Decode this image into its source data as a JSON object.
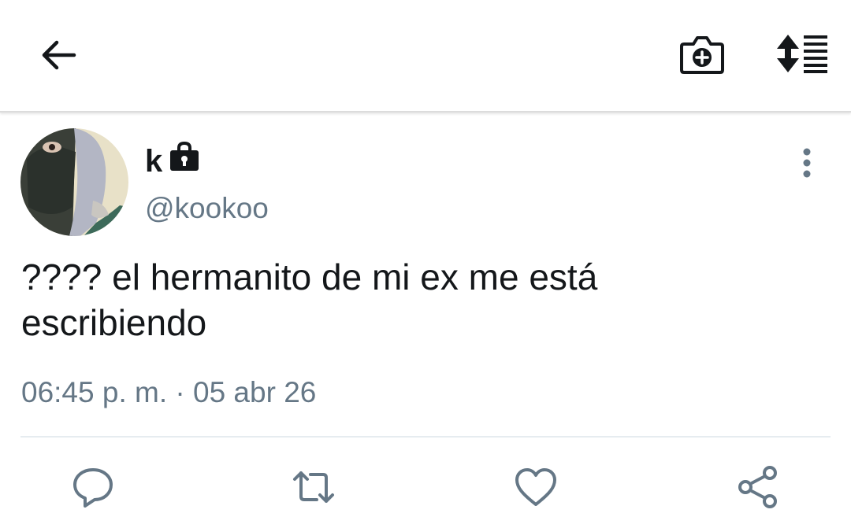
{
  "header": {
    "back_icon": "arrow-left-icon",
    "camera_icon": "camera-plus-icon",
    "sort_icon": "sort-list-icon"
  },
  "tweet": {
    "display_name": "k",
    "protected_icon": "lock-icon",
    "handle": "@kookoo",
    "text": "???? el hermanito de mi ex me está\nescribiendo",
    "time": "06:45 p. m.",
    "separator": "·",
    "date": "05 abr 26",
    "actions": {
      "reply_icon": "reply-icon",
      "retweet_icon": "retweet-icon",
      "like_icon": "heart-icon",
      "share_icon": "share-icon"
    }
  },
  "colors": {
    "text_primary": "#14171a",
    "text_secondary": "#657786",
    "icon_action": "#657786",
    "divider": "#e6ecf0"
  }
}
